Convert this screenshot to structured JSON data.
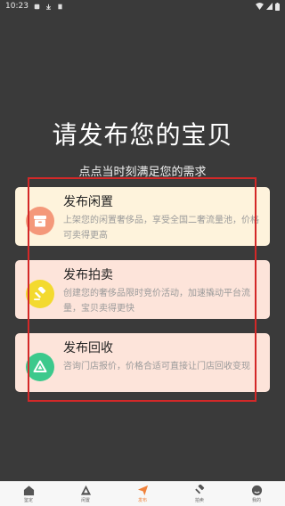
{
  "status_bar": {
    "time": "10:23"
  },
  "hero": {
    "title": "请发布您的宝贝",
    "subtitle": "点点当时刻满足您的需求"
  },
  "cards": [
    {
      "title": "发布闲置",
      "description": "上架您的闲置奢侈品，享受全国二奢流量池，价格可卖得更高",
      "icon": "box-icon"
    },
    {
      "title": "发布拍卖",
      "description": "创建您的奢侈品限时竞价活动，加速撬动平台流量，宝贝卖得更快",
      "icon": "hammer-icon"
    },
    {
      "title": "发布回收",
      "description": "咨询门店报价，价格合适可直接让门店回收变现",
      "icon": "recycle-icon"
    }
  ],
  "tab_bar": {
    "items": [
      {
        "label": "鉴定",
        "icon": "home-icon"
      },
      {
        "label": "闲置",
        "icon": "triangle-icon"
      },
      {
        "label": "发布",
        "icon": "send-icon"
      },
      {
        "label": "拍卖",
        "icon": "hammer-icon"
      },
      {
        "label": "我的",
        "icon": "profile-icon"
      }
    ],
    "active_index": 2
  },
  "colors": {
    "background": "#3a3a3a",
    "card_idle_bg": "#fef3dc",
    "card_other_bg": "#fde4da",
    "icon_idle": "#f4987a",
    "icon_auction": "#f3da2f",
    "icon_recycle": "#3cc98c",
    "highlight": "#d32828",
    "tab_active": "#f0813a"
  }
}
